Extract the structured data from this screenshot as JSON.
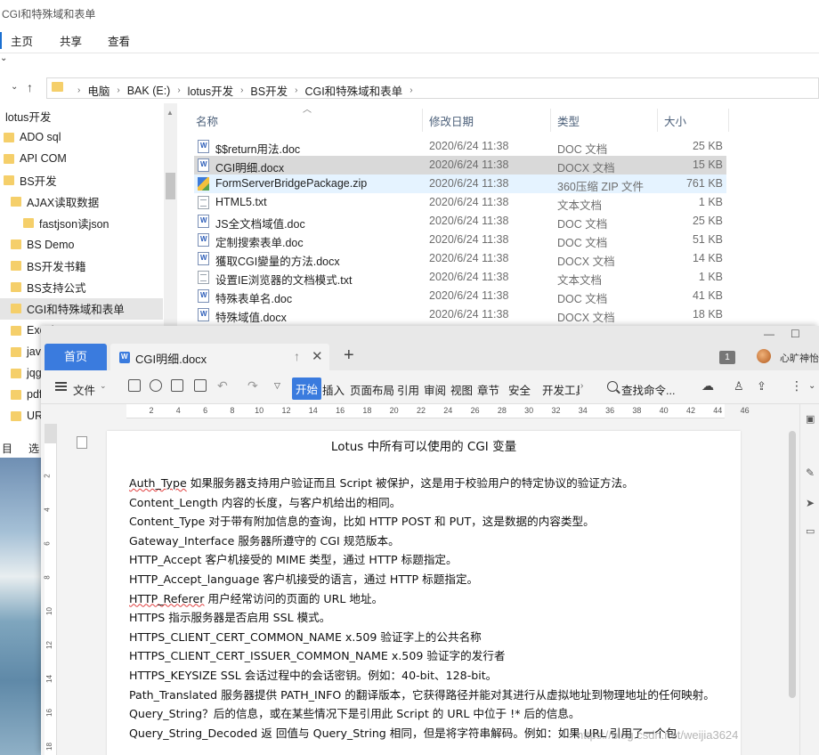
{
  "explorer": {
    "title": "CGI和特殊域和表单",
    "ribbon_tabs": [
      "主页",
      "共享",
      "查看"
    ],
    "path": [
      "电脑",
      "BAK (E:)",
      "lotus开发",
      "BS开发",
      "CGI和特殊域和表单"
    ],
    "nav_items": [
      {
        "label": "lotus开发",
        "indent": 0,
        "folder": false
      },
      {
        "label": "ADO sql",
        "indent": 0,
        "folder": true
      },
      {
        "label": "API COM",
        "indent": 0,
        "folder": true
      },
      {
        "label": "BS开发",
        "indent": 0,
        "folder": true
      },
      {
        "label": "AJAX读取数据",
        "indent": 1,
        "folder": true
      },
      {
        "label": "fastjson读json",
        "indent": 2,
        "folder": true
      },
      {
        "label": "BS Demo",
        "indent": 1,
        "folder": true
      },
      {
        "label": "BS开发书籍",
        "indent": 1,
        "folder": true
      },
      {
        "label": "BS支持公式",
        "indent": 1,
        "folder": true
      },
      {
        "label": "CGI和特殊域和表单",
        "indent": 1,
        "folder": true,
        "selected": true
      },
      {
        "label": "Excel",
        "indent": 1,
        "folder": true
      },
      {
        "label": "java",
        "indent": 1,
        "folder": true
      },
      {
        "label": "jqgr",
        "indent": 1,
        "folder": true
      },
      {
        "label": "pdf",
        "indent": 1,
        "folder": true
      },
      {
        "label": "URL",
        "indent": 1,
        "folder": true
      }
    ],
    "columns": {
      "name": "名称",
      "date": "修改日期",
      "type": "类型",
      "size": "大小"
    },
    "files": [
      {
        "name": "$$return用法.doc",
        "date": "2020/6/24 11:38",
        "type": "DOC 文档",
        "size": "25 KB",
        "icon": "word"
      },
      {
        "name": "CGI明细.docx",
        "date": "2020/6/24 11:38",
        "type": "DOCX 文档",
        "size": "15 KB",
        "icon": "word",
        "state": "selected"
      },
      {
        "name": "FormServerBridgePackage.zip",
        "date": "2020/6/24 11:38",
        "type": "360压缩 ZIP 文件",
        "size": "761 KB",
        "icon": "zip",
        "state": "hover"
      },
      {
        "name": "HTML5.txt",
        "date": "2020/6/24 11:38",
        "type": "文本文档",
        "size": "1 KB",
        "icon": "txt"
      },
      {
        "name": "JS全文档域值.doc",
        "date": "2020/6/24 11:38",
        "type": "DOC 文档",
        "size": "25 KB",
        "icon": "word"
      },
      {
        "name": "定制搜索表单.doc",
        "date": "2020/6/24 11:38",
        "type": "DOC 文档",
        "size": "51 KB",
        "icon": "word"
      },
      {
        "name": "獲取CGI變量的方法.docx",
        "date": "2020/6/24 11:38",
        "type": "DOCX 文档",
        "size": "14 KB",
        "icon": "word"
      },
      {
        "name": "设置IE浏览器的文档模式.txt",
        "date": "2020/6/24 11:38",
        "type": "文本文档",
        "size": "1 KB",
        "icon": "txt"
      },
      {
        "name": "特殊表单名.doc",
        "date": "2020/6/24 11:38",
        "type": "DOC 文档",
        "size": "41 KB",
        "icon": "word"
      },
      {
        "name": "特殊域值.docx",
        "date": "2020/6/24 11:38",
        "type": "DOCX 文档",
        "size": "18 KB",
        "icon": "word"
      }
    ],
    "status_left": "目",
    "status_right": "选"
  },
  "wps": {
    "home_tab": "首页",
    "doc_tab": "CGI明细.docx",
    "badge": "1",
    "user_name": "心旷神怡",
    "menu": {
      "file": "文件",
      "start": "开始",
      "items": [
        "插入",
        "页面布局",
        "引用",
        "审阅",
        "视图",
        "章节",
        "安全",
        "开发工具"
      ],
      "search": "查找命令..."
    },
    "ruler_ticks": [
      "2",
      "4",
      "6",
      "8",
      "10",
      "12",
      "14",
      "16",
      "18",
      "20",
      "22",
      "24",
      "26",
      "28",
      "30",
      "32",
      "34",
      "36",
      "38",
      "40",
      "42",
      "44",
      "46"
    ],
    "vruler_ticks": [
      "2",
      "4",
      "6",
      "8",
      "10",
      "12",
      "14",
      "16",
      "18"
    ],
    "document": {
      "title": "Lotus 中所有可以使用的 CGI 变量",
      "lines": [
        {
          "key": "Auth_Type",
          "text": " 如果服务器支持用户验证而且 Script 被保护，这是用于校验用户的特定协议的验证方法。",
          "squig": true
        },
        {
          "key": "Content_Length",
          "text": " 内容的长度，与客户机给出的相同。"
        },
        {
          "key": "Content_Type",
          "text": " 对于带有附加信息的查询，比如 HTTP POST 和 PUT，这是数据的内容类型。"
        },
        {
          "key": "Gateway_Interface",
          "text": " 服务器所遵守的 CGI 规范版本。"
        },
        {
          "key": "HTTP_Accept",
          "text": " 客户机接受的 MIME 类型，通过 HTTP 标题指定。"
        },
        {
          "key": "HTTP_Accept_language",
          "text": " 客户机接受的语言，通过 HTTP 标题指定。"
        },
        {
          "key": "HTTP_Referer",
          "text": " 用户经常访问的页面的 URL 地址。",
          "squig": true
        },
        {
          "key": "HTTPS",
          "text": " 指示服务器是否启用 SSL 模式。"
        },
        {
          "key": "HTTPS_CLIENT_CERT_COMMON_NAME",
          "text": " x.509 验证字上的公共名称"
        },
        {
          "key": "HTTPS_CLIENT_CERT_ISSUER_COMMON_NAME",
          "text": " x.509 验证字的发行者"
        },
        {
          "key": "HTTPS_KEYSIZE",
          "text": " SSL 会话过程中的会话密钥。例如：40-bit、128-bit。"
        },
        {
          "key": "Path_Translated",
          "text": " 服务器提供 PATH_INFO 的翻译版本，它获得路径并能对其进行从虚拟地址到物理地址的任何映射。",
          "wrap": true
        },
        {
          "key": "Query_String",
          "text": "？后的信息，或在某些情况下是引用此 Script 的 URL 中位于 !* 后的信息。"
        },
        {
          "key": "Query_String_Decoded",
          "text": " 返 回值与 Query_String 相同，但是将字符串解码。例如：如果 URL 引用了一个包"
        }
      ]
    }
  },
  "watermark": "https://blog.csdn.net/weijia3624"
}
